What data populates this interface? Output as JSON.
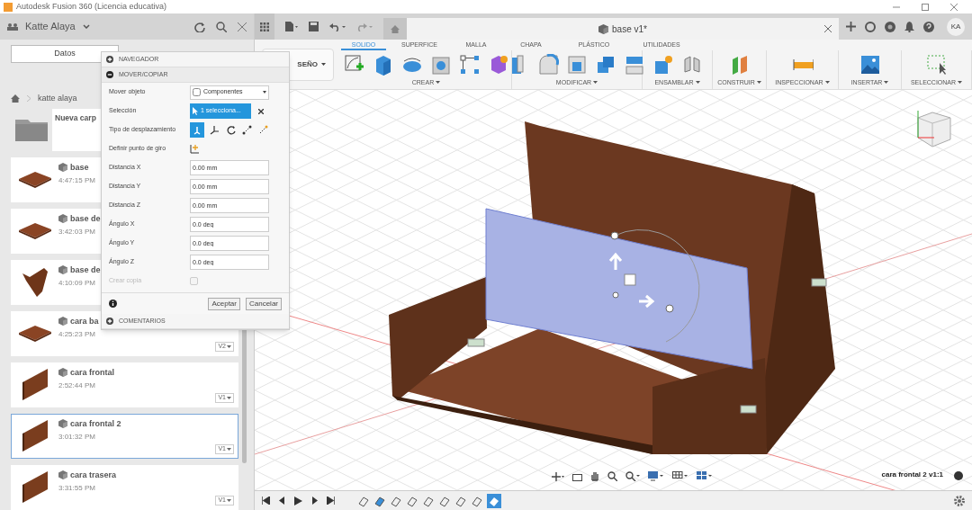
{
  "window": {
    "title": "Autodesk Fusion 360 (Licencia educativa)"
  },
  "data_panel": {
    "user": "Katte Alaya",
    "tabs": [
      {
        "label": "Datos",
        "selected": true
      }
    ],
    "breadcrumb": "katte alaya",
    "folder": "Nueva carp",
    "items": [
      {
        "name": "base",
        "time": "4:47:15 PM",
        "selected": false
      },
      {
        "name": "base de",
        "time": "3:42:03 PM",
        "selected": false
      },
      {
        "name": "base de",
        "time": "4:10:09 PM",
        "selected": false
      },
      {
        "name": "cara ba",
        "time": "4:25:23 PM",
        "selected": false,
        "version": "V2"
      },
      {
        "name": "cara frontal",
        "time": "2:52:44 PM",
        "selected": false,
        "version": "V1"
      },
      {
        "name": "cara frontal 2",
        "time": "3:01:32 PM",
        "selected": true,
        "version": "V1"
      },
      {
        "name": "cara trasera",
        "time": "3:31:55 PM",
        "selected": false,
        "version": "V1"
      }
    ]
  },
  "document_tab": {
    "title": "base v1*"
  },
  "user_badge": "KA",
  "workspace": "SEÑO",
  "ribbon_tabs": [
    {
      "label": "SOLIDO",
      "selected": true
    },
    {
      "label": "SUPERFICE",
      "selected": false
    },
    {
      "label": "MALLA",
      "selected": false
    },
    {
      "label": "CHAPA",
      "selected": false
    },
    {
      "label": "PLÁSTICO",
      "selected": false
    },
    {
      "label": "UTILIDADES",
      "selected": false
    }
  ],
  "ribbon_groups": [
    {
      "label": "CREAR"
    },
    {
      "label": "MODIFICAR"
    },
    {
      "label": "ENSAMBLAR"
    },
    {
      "label": "CONSTRUIR"
    },
    {
      "label": "INSPECCIONAR"
    },
    {
      "label": "INSERTAR"
    },
    {
      "label": "SELECCIONAR"
    }
  ],
  "dialog": {
    "sections": [
      {
        "label": "NAVEGADOR",
        "expanded": false
      },
      {
        "label": "MOVER/COPIAR",
        "expanded": true
      }
    ],
    "rows": [
      {
        "kind": "select",
        "label": "Mover objeto",
        "value": "Componentes"
      },
      {
        "kind": "selection",
        "label": "Selección",
        "value": "1 selecciona..."
      },
      {
        "kind": "movetype",
        "label": "Tipo de desplazamiento"
      },
      {
        "kind": "pivot",
        "label": "Definir punto de giro"
      },
      {
        "kind": "input",
        "label": "Distancia X",
        "value": "0.00 mm"
      },
      {
        "kind": "input",
        "label": "Distancia Y",
        "value": "0.00 mm"
      },
      {
        "kind": "input",
        "label": "Distancia Z",
        "value": "0.00 mm"
      },
      {
        "kind": "input",
        "label": "Ángulo X",
        "value": "0.0 deg"
      },
      {
        "kind": "input",
        "label": "Ángulo Y",
        "value": "0.0 deg"
      },
      {
        "kind": "input",
        "label": "Ángulo Z",
        "value": "0.0 deg"
      },
      {
        "kind": "checkbox",
        "label": "Crear copia",
        "checked": false,
        "disabled": true
      }
    ],
    "buttons": [
      "Aceptar",
      "Cancelar"
    ],
    "comments": {
      "label": "COMENTARIOS",
      "expanded": false
    }
  },
  "viewport": {
    "component_label": "cara frontal 2 v1:1"
  }
}
